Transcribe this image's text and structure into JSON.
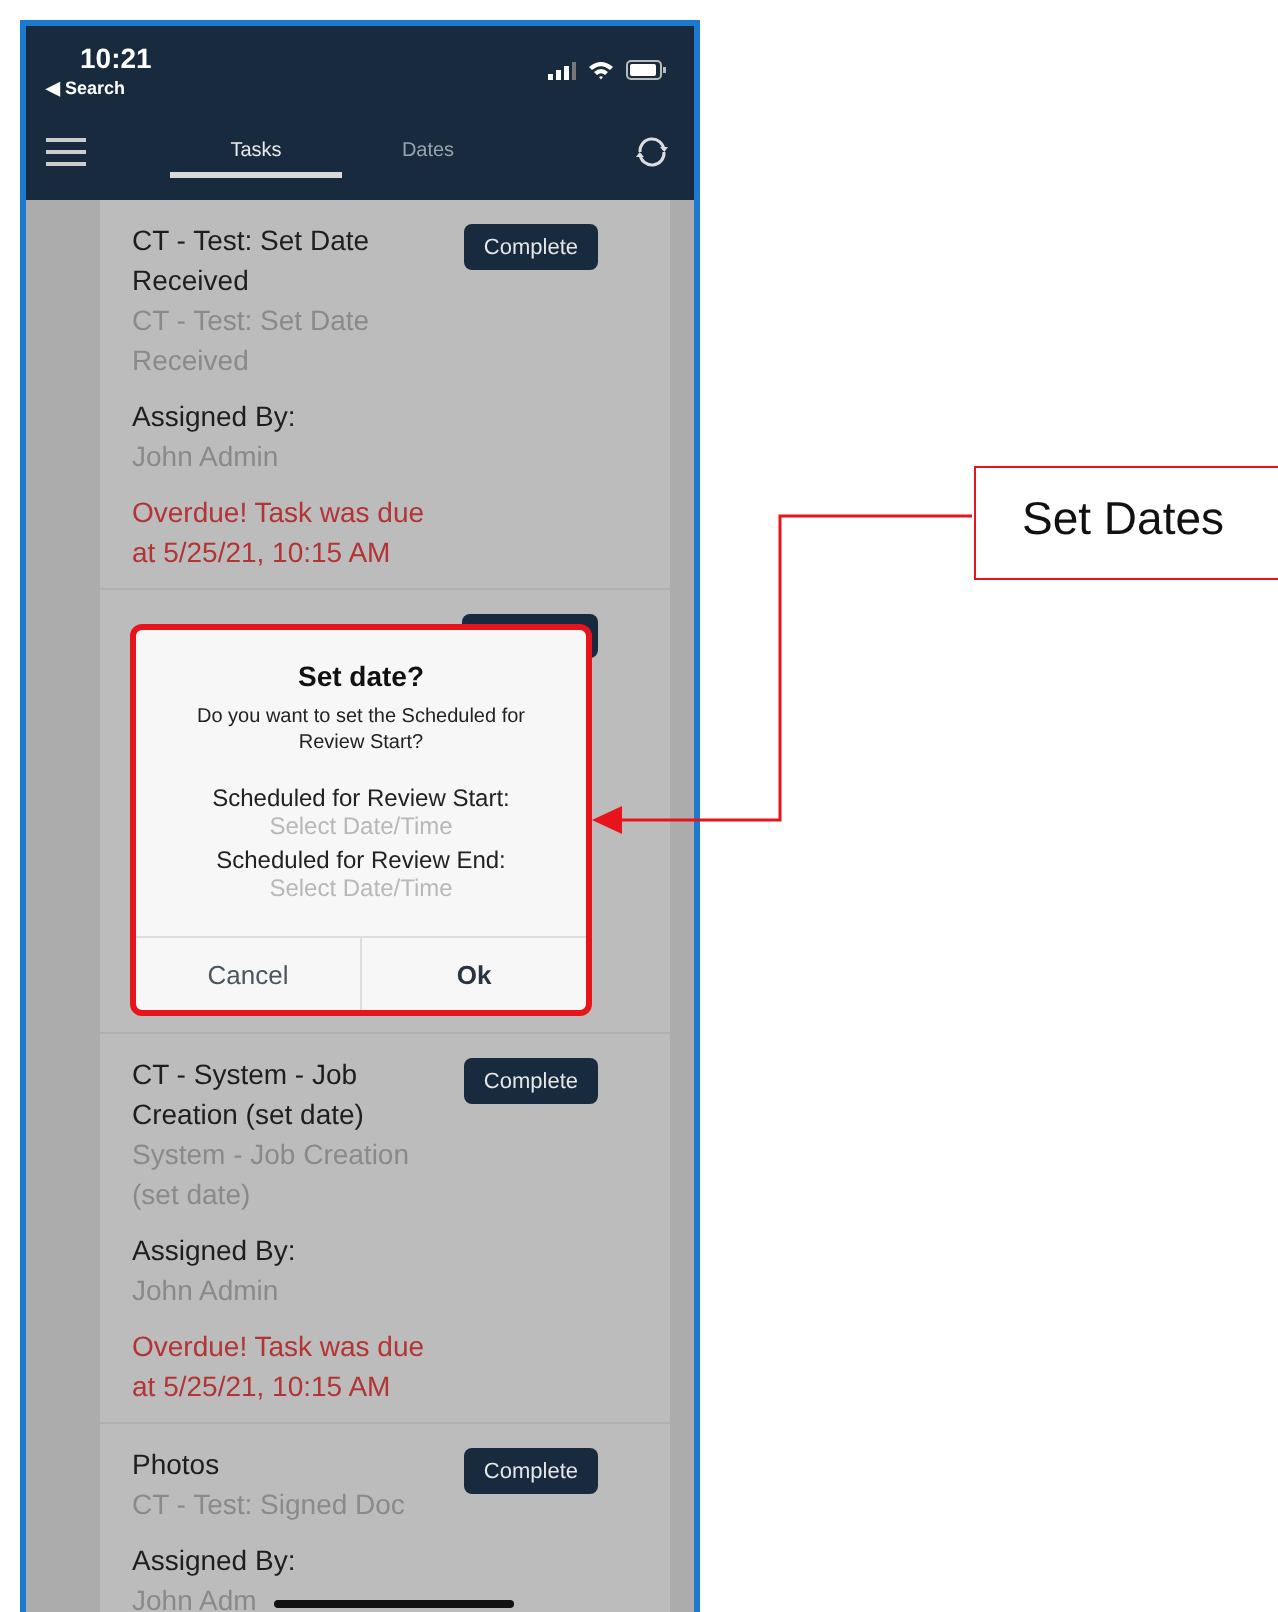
{
  "status_bar": {
    "time": "10:21",
    "back_label": "◀ Search"
  },
  "nav": {
    "tabs": [
      {
        "label": "Tasks",
        "selected": true
      },
      {
        "label": "Dates",
        "selected": false
      }
    ]
  },
  "tasks": [
    {
      "kind": "task",
      "title": "CT - Test: Set Date Received",
      "subtitle": "CT - Test: Set Date Received",
      "assigned_label": "Assigned By:",
      "assigned_by": "John Admin",
      "overdue": "Overdue! Task was due at 5/25/21, 10:15 AM",
      "button": "Complete"
    },
    {
      "kind": "covered"
    },
    {
      "kind": "task",
      "title": "CT - System - Job Creation (set date)",
      "subtitle": "System - Job Creation (set date)",
      "assigned_label": "Assigned By:",
      "assigned_by": "John Admin",
      "overdue": "Overdue! Task was due at 5/25/21, 10:15 AM",
      "button": "Complete"
    },
    {
      "kind": "task",
      "title": "Photos",
      "subtitle": "CT - Test: Signed Doc",
      "assigned_label": "Assigned By:",
      "assigned_by": "John Adm",
      "button": "Complete"
    }
  ],
  "dialog": {
    "title": "Set date?",
    "message": "Do you want to set the Scheduled for Review Start?",
    "fields": [
      {
        "label": "Scheduled for Review Start:",
        "placeholder": "Select Date/Time"
      },
      {
        "label": "Scheduled for Review End:",
        "placeholder": "Select Date/Time"
      }
    ],
    "buttons": [
      {
        "label": "Cancel",
        "kind": "cancel"
      },
      {
        "label": "Ok",
        "kind": "confirm"
      }
    ]
  },
  "callout": {
    "label": "Set Dates"
  }
}
